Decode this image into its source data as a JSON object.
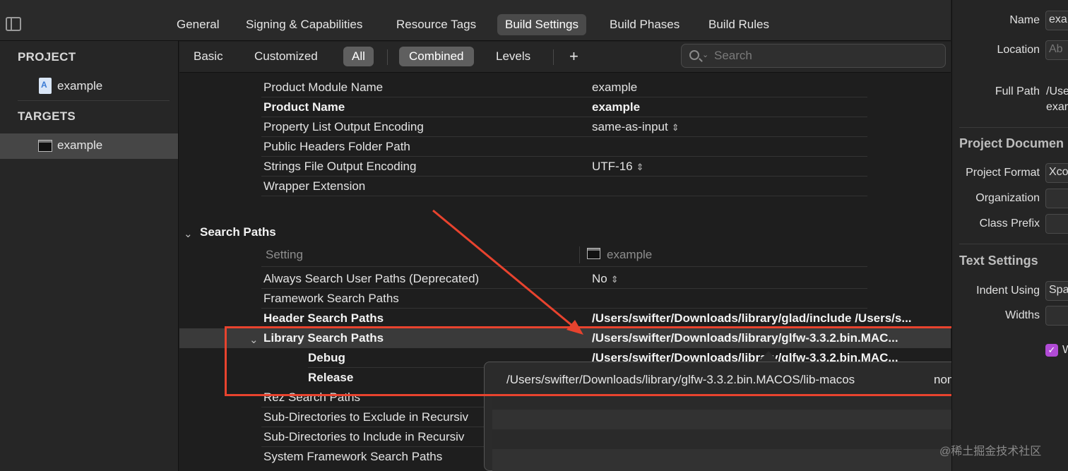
{
  "top_tabs": {
    "general": "General",
    "signing": "Signing & Capabilities",
    "resource_tags": "Resource Tags",
    "build_settings": "Build Settings",
    "build_phases": "Build Phases",
    "build_rules": "Build Rules",
    "active": "Build Settings"
  },
  "sidebar": {
    "project_header": "PROJECT",
    "project_item": "example",
    "targets_header": "TARGETS",
    "target_item": "example"
  },
  "filter_bar": {
    "basic": "Basic",
    "customized": "Customized",
    "all": "All",
    "combined": "Combined",
    "levels": "Levels",
    "add": "+",
    "search_placeholder": "Search"
  },
  "packaging_rows": [
    {
      "name": "Product Module Name",
      "value": "example",
      "bold": false
    },
    {
      "name": "Product Name",
      "value": "example",
      "bold": true
    },
    {
      "name": "Property List Output Encoding",
      "value": "same-as-input",
      "bold": false
    },
    {
      "name": "Public Headers Folder Path",
      "value": "",
      "bold": false
    },
    {
      "name": "Strings File Output Encoding",
      "value": "UTF-16",
      "bold": false
    },
    {
      "name": "Wrapper Extension",
      "value": "",
      "bold": false
    }
  ],
  "search_paths": {
    "section_title": "Search Paths",
    "column_setting": "Setting",
    "column_target": "example",
    "rows": [
      {
        "name": "Always Search User Paths (Deprecated)",
        "value": "No"
      },
      {
        "name": "Framework Search Paths",
        "value": ""
      },
      {
        "name": "Header Search Paths",
        "value": "/Users/swifter/Downloads/library/glad/include /Users/s..."
      },
      {
        "name": "Library Search Paths",
        "value": "/Users/swifter/Downloads/library/glfw-3.3.2.bin.MAC..."
      },
      {
        "name": "Debug",
        "value": "/Users/swifter/Downloads/library/glfw-3.3.2.bin.MAC..."
      },
      {
        "name": "Release",
        "value": ""
      },
      {
        "name": "Rez Search Paths",
        "value": ""
      },
      {
        "name": "Sub-Directories to Exclude in Recursiv",
        "value": ""
      },
      {
        "name": "Sub-Directories to Include in Recursiv",
        "value": ""
      },
      {
        "name": "System Framework Search Paths",
        "value": ""
      }
    ]
  },
  "popover": {
    "path": "/Users/swifter/Downloads/library/glfw-3.3.2.bin.MACOS/lib-macos",
    "recursive": "non-recursive"
  },
  "inspector": {
    "name_label": "Name",
    "name_value": "exa",
    "location_label": "Location",
    "location_value": "Ab",
    "full_path_label": "Full Path",
    "full_path_value_1": "/Use",
    "full_path_value_2": "exar",
    "project_document_header": "Project Documen",
    "project_format_label": "Project Format",
    "project_format_value": "Xco",
    "organization_label": "Organization",
    "class_prefix_label": "Class Prefix",
    "text_settings_header": "Text Settings",
    "indent_using_label": "Indent Using",
    "indent_using_value": "Spa",
    "widths_label": "Widths",
    "wrap_label": "W",
    "checkbox_mark": "✓"
  },
  "watermark": "@稀土掘金技术社区",
  "colors": {
    "annotation_red": "#e8432e",
    "checkbox_purple": "#b14bd6"
  }
}
